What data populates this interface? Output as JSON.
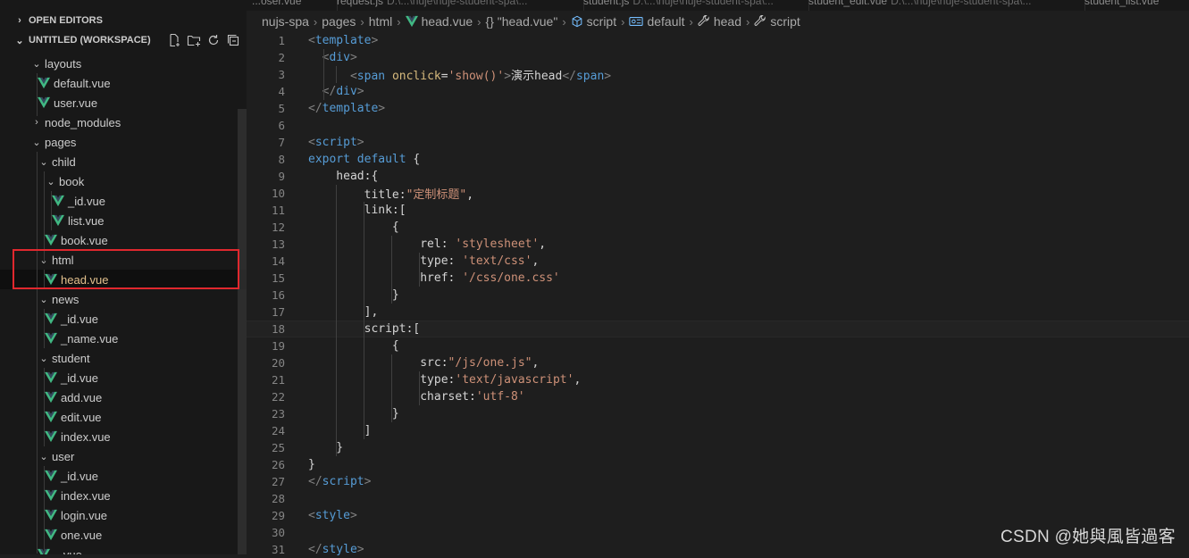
{
  "tabs": [
    {
      "label": "...oser.vue",
      "desc": ""
    },
    {
      "label": "request.js",
      "desc": "D:\\...\\nuje\\nuje-student-spa\\..."
    },
    {
      "label": "student.js",
      "desc": "D:\\...\\nuje\\nuje-student-spa\\..."
    },
    {
      "label": "student_edit.vue",
      "desc": "D:\\...\\nuje\\nuje-student-spa\\..."
    },
    {
      "label": "student_list.vue",
      "desc": ""
    }
  ],
  "explorer": {
    "open_editors": "OPEN EDITORS",
    "workspace": "UNTITLED (WORKSPACE)",
    "tree": [
      {
        "label": "layouts",
        "type": "folder-open"
      },
      {
        "label": "default.vue",
        "type": "vue"
      },
      {
        "label": "user.vue",
        "type": "vue"
      },
      {
        "label": "node_modules",
        "type": "folder-closed"
      },
      {
        "label": "pages",
        "type": "folder-open"
      },
      {
        "label": "child",
        "type": "folder-open"
      },
      {
        "label": "book",
        "type": "folder-open"
      },
      {
        "label": "_id.vue",
        "type": "vue"
      },
      {
        "label": "list.vue",
        "type": "vue"
      },
      {
        "label": "book.vue",
        "type": "vue"
      },
      {
        "label": "html",
        "type": "folder-open"
      },
      {
        "label": "head.vue",
        "type": "vue",
        "selected": true
      },
      {
        "label": "news",
        "type": "folder-open"
      },
      {
        "label": "_id.vue",
        "type": "vue"
      },
      {
        "label": "_name.vue",
        "type": "vue"
      },
      {
        "label": "student",
        "type": "folder-open"
      },
      {
        "label": "_id.vue",
        "type": "vue"
      },
      {
        "label": "add.vue",
        "type": "vue"
      },
      {
        "label": "edit.vue",
        "type": "vue"
      },
      {
        "label": "index.vue",
        "type": "vue"
      },
      {
        "label": "user",
        "type": "folder-open"
      },
      {
        "label": "_id.vue",
        "type": "vue"
      },
      {
        "label": "index.vue",
        "type": "vue"
      },
      {
        "label": "login.vue",
        "type": "vue"
      },
      {
        "label": "one.vue",
        "type": "vue"
      },
      {
        "label": "...vue",
        "type": "vue"
      }
    ]
  },
  "breadcrumb": [
    {
      "label": "nujs-spa",
      "icon": ""
    },
    {
      "label": "pages",
      "icon": ""
    },
    {
      "label": "html",
      "icon": ""
    },
    {
      "label": "head.vue",
      "icon": "vue-icon"
    },
    {
      "label": "{} \"head.vue\"",
      "icon": ""
    },
    {
      "label": "script",
      "icon": "cube-icon"
    },
    {
      "label": "default",
      "icon": "symbol-icon"
    },
    {
      "label": "head",
      "icon": "wrench-icon"
    },
    {
      "label": "script",
      "icon": "wrench-icon"
    }
  ],
  "editor": {
    "current_line": 18,
    "lines": [
      [
        [
          "t-br",
          "<"
        ],
        [
          "t-tag",
          "template"
        ],
        [
          "t-br",
          ">"
        ]
      ],
      [
        [
          "",
          "  "
        ],
        [
          "t-br",
          "<"
        ],
        [
          "t-tag",
          "div"
        ],
        [
          "t-br",
          ">"
        ]
      ],
      [
        [
          "",
          "      "
        ],
        [
          "t-br",
          "<"
        ],
        [
          "t-tag",
          "span"
        ],
        [
          "",
          " "
        ],
        [
          "t-ev",
          "onclick"
        ],
        [
          "",
          "="
        ],
        [
          "t-str",
          "'show()'"
        ],
        [
          "t-br",
          ">"
        ],
        [
          "",
          "演示head"
        ],
        [
          "t-br",
          "</"
        ],
        [
          "t-tag",
          "span"
        ],
        [
          "t-br",
          ">"
        ]
      ],
      [
        [
          "",
          "  "
        ],
        [
          "t-br",
          "</"
        ],
        [
          "t-tag",
          "div"
        ],
        [
          "t-br",
          ">"
        ]
      ],
      [
        [
          "t-br",
          "</"
        ],
        [
          "t-tag",
          "template"
        ],
        [
          "t-br",
          ">"
        ]
      ],
      [],
      [
        [
          "t-br",
          "<"
        ],
        [
          "t-tag",
          "script"
        ],
        [
          "t-br",
          ">"
        ]
      ],
      [
        [
          "t-kw",
          "export"
        ],
        [
          "",
          " "
        ],
        [
          "t-kw",
          "default"
        ],
        [
          "",
          " {"
        ]
      ],
      [
        [
          "",
          "    head:{"
        ]
      ],
      [
        [
          "",
          "        title:"
        ],
        [
          "t-str",
          "\"定制标题\""
        ],
        [
          "",
          ","
        ]
      ],
      [
        [
          "",
          "        link:["
        ]
      ],
      [
        [
          "",
          "            {"
        ]
      ],
      [
        [
          "",
          "                rel: "
        ],
        [
          "t-str",
          "'stylesheet'"
        ],
        [
          "",
          ","
        ]
      ],
      [
        [
          "",
          "                type: "
        ],
        [
          "t-str",
          "'text/css'"
        ],
        [
          "",
          ","
        ]
      ],
      [
        [
          "",
          "                href: "
        ],
        [
          "t-str",
          "'/css/one.css'"
        ]
      ],
      [
        [
          "",
          "            }"
        ]
      ],
      [
        [
          "",
          "        ],"
        ]
      ],
      [
        [
          "",
          "        script:["
        ]
      ],
      [
        [
          "",
          "            {"
        ]
      ],
      [
        [
          "",
          "                src:"
        ],
        [
          "t-str",
          "\"/js/one.js\""
        ],
        [
          "",
          ","
        ]
      ],
      [
        [
          "",
          "                type:"
        ],
        [
          "t-str",
          "'text/javascript'"
        ],
        [
          "",
          ","
        ]
      ],
      [
        [
          "",
          "                charset:"
        ],
        [
          "t-str",
          "'utf-8'"
        ]
      ],
      [
        [
          "",
          "            }"
        ]
      ],
      [
        [
          "",
          "        ]"
        ]
      ],
      [
        [
          "",
          "    }"
        ]
      ],
      [
        [
          "",
          "}"
        ]
      ],
      [
        [
          "t-br",
          "</"
        ],
        [
          "t-tag",
          "script"
        ],
        [
          "t-br",
          ">"
        ]
      ],
      [],
      [
        [
          "t-br",
          "<"
        ],
        [
          "t-tag",
          "style"
        ],
        [
          "t-br",
          ">"
        ]
      ],
      [],
      [
        [
          "t-br",
          "</"
        ],
        [
          "t-tag",
          "style"
        ],
        [
          "t-br",
          ">"
        ]
      ]
    ]
  },
  "watermark": "CSDN @她與風皆過客",
  "colors": {
    "accent_red": "#e0282e",
    "vue_green": "#41b883",
    "selected_text": "#e2c08d"
  }
}
